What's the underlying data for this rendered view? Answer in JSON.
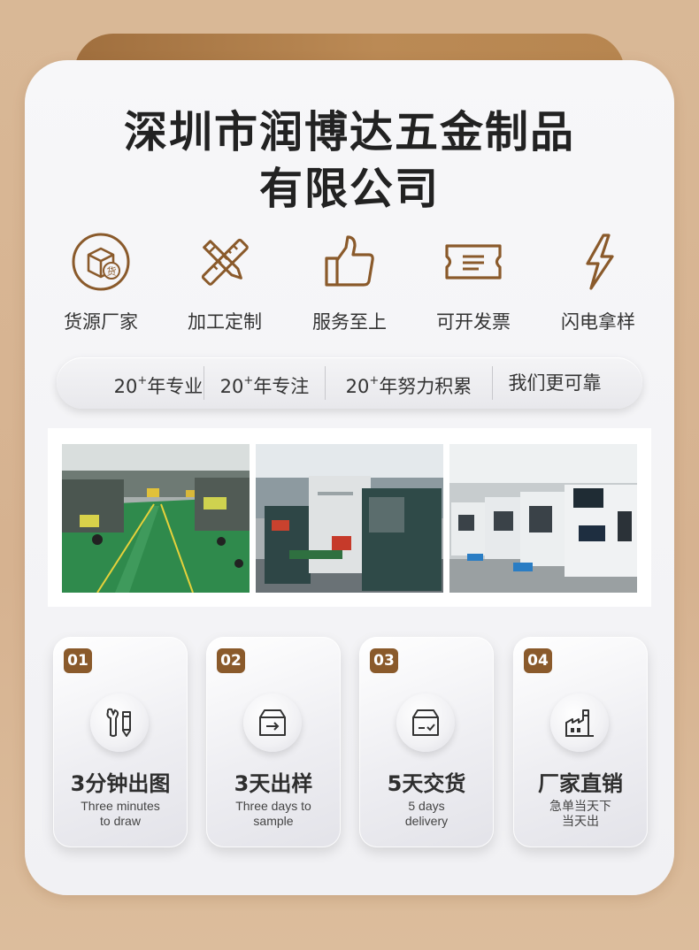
{
  "title": {
    "line1": "深圳市润博达五金制品",
    "line2": "有限公司"
  },
  "features": [
    {
      "label": "货源厂家",
      "icon": "box-icon",
      "badge": "货"
    },
    {
      "label": "加工定制",
      "icon": "ruler-pencil-icon"
    },
    {
      "label": "服务至上",
      "icon": "thumbs-up-icon"
    },
    {
      "label": "可开发票",
      "icon": "invoice-icon"
    },
    {
      "label": "闪电拿样",
      "icon": "lightning-icon"
    }
  ],
  "highlights": [
    {
      "num": "20",
      "sup": "+",
      "text": "年专业"
    },
    {
      "num": "20",
      "sup": "+",
      "text": "年专注"
    },
    {
      "num": "20",
      "sup": "+",
      "text": "年努力积累"
    },
    {
      "num": "",
      "sup": "",
      "text": "我们更可靠"
    }
  ],
  "photos": [
    {
      "name": "factory-floor-photo"
    },
    {
      "name": "machine-line-photo"
    },
    {
      "name": "cnc-lathes-photo"
    }
  ],
  "steps": [
    {
      "num": "01",
      "title": "3分钟出图",
      "sub1": "Three minutes",
      "sub2": "to draw",
      "icon": "tools-icon"
    },
    {
      "num": "02",
      "title": "3天出样",
      "sub1": "Three days to",
      "sub2": "sample",
      "icon": "sample-box-icon"
    },
    {
      "num": "03",
      "title": "5天交货",
      "sub1": "5 days",
      "sub2": "delivery",
      "icon": "delivery-box-icon"
    },
    {
      "num": "04",
      "title": "厂家直销",
      "sub1": "急单当天下",
      "sub2": "当天出",
      "icon": "factory-icon"
    }
  ],
  "colors": {
    "accent": "#8a5a2b",
    "background": "#d9b896",
    "card": "#f5f5f7"
  }
}
